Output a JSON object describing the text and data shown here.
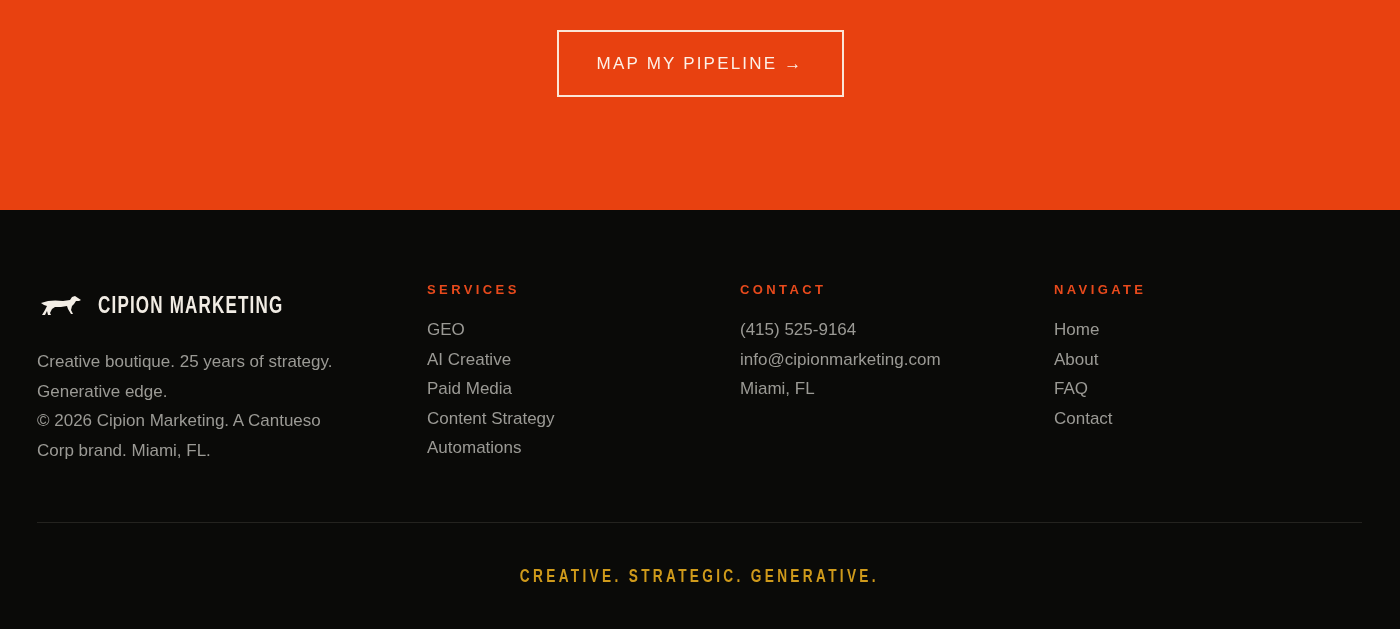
{
  "cta": {
    "label": "MAP MY PIPELINE →"
  },
  "footer": {
    "brand": {
      "name": "CIPION MARKETING",
      "description": "Creative boutique. 25 years of strategy. Generative edge.",
      "copyright": "© 2026 Cipion Marketing. A Cantueso Corp brand. Miami, FL."
    },
    "columns": [
      {
        "heading": "SERVICES",
        "links": [
          "GEO",
          "AI Creative",
          "Paid Media",
          "Content Strategy",
          "Automations"
        ]
      },
      {
        "heading": "CONTACT",
        "links": [
          "(415) 525-9164",
          "info@cipionmarketing.com",
          "Miami, FL"
        ]
      },
      {
        "heading": "NAVIGATE",
        "links": [
          "Home",
          "About",
          "FAQ",
          "Contact"
        ]
      }
    ],
    "tagline": "CREATIVE. STRATEGIC. GENERATIVE."
  }
}
